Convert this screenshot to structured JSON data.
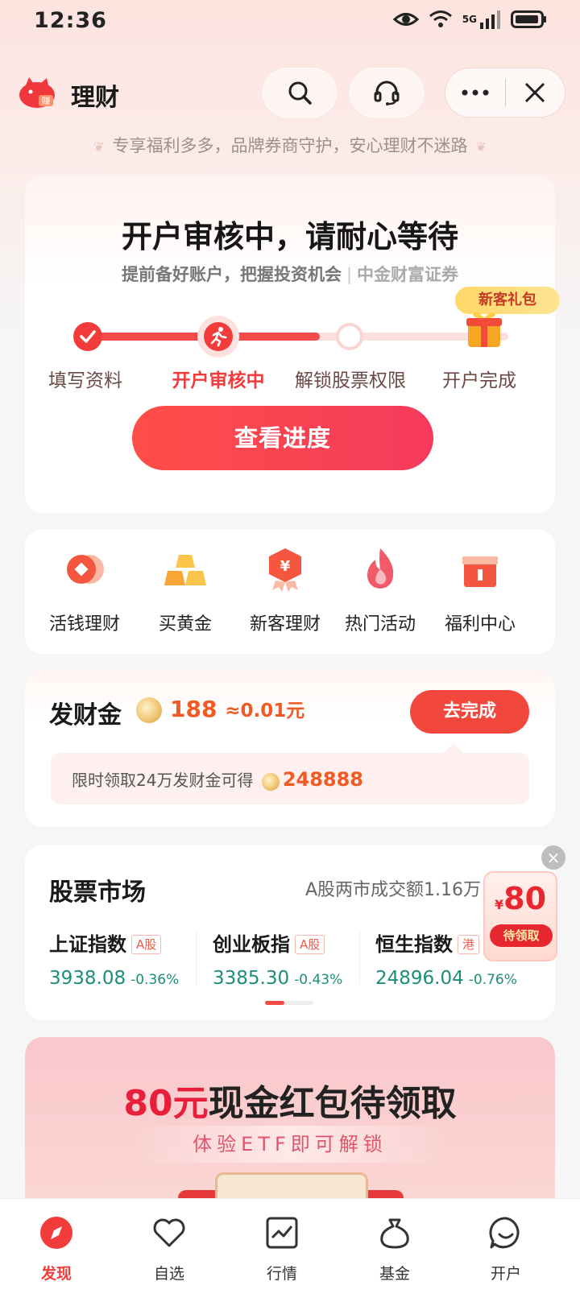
{
  "status_bar": {
    "time": "12:36",
    "network": "5G"
  },
  "header": {
    "title": "理财",
    "slogan": "专享福利多多，品牌券商守护，安心理财不迷路"
  },
  "account_card": {
    "headline": "开户审核中，请耐心等待",
    "subtitle": "提前备好账户，把握投资机会",
    "broker": "中金财富证券",
    "gift_badge": "新客礼包",
    "steps": [
      {
        "label": "填写资料",
        "state": "done"
      },
      {
        "label": "开户审核中",
        "state": "active"
      },
      {
        "label": "解锁股票权限",
        "state": "pending"
      },
      {
        "label": "开户完成",
        "state": "pending"
      }
    ],
    "progress_fraction": 0.55,
    "button_label": "查看进度"
  },
  "quick_entries": [
    {
      "label": "活钱理财",
      "icon": "coin-stack-icon"
    },
    {
      "label": "买黄金",
      "icon": "gold-bars-icon"
    },
    {
      "label": "新客理财",
      "icon": "yuan-badge-icon"
    },
    {
      "label": "热门活动",
      "icon": "flame-icon"
    },
    {
      "label": "福利中心",
      "icon": "gift-box-icon"
    }
  ],
  "bonus": {
    "title": "发财金",
    "amount": "188",
    "approx": "≈0.01元",
    "button_label": "去完成",
    "hint": "限时领取24万发财金可得",
    "hint_amount": "248888"
  },
  "market": {
    "title": "股票市场",
    "turnover": "A股两市成交额1.16万",
    "indices": [
      {
        "name": "上证指数",
        "tag": "A股",
        "value": "3938.08",
        "change": "-0.36%"
      },
      {
        "name": "创业板指",
        "tag": "A股",
        "value": "3385.30",
        "change": "-0.43%"
      },
      {
        "name": "恒生指数",
        "tag": "港",
        "value": "24896.04",
        "change": "-0.76%"
      }
    ]
  },
  "floating_redpacket": {
    "currency": "¥",
    "amount": "80",
    "claim_label": "待领取"
  },
  "banner": {
    "highlight": "80元",
    "headline_rest": "现金红包待领取",
    "strip": "体验ETF即可解锁"
  },
  "tabbar": [
    {
      "label": "发现",
      "icon": "compass-icon",
      "active": true
    },
    {
      "label": "自选",
      "icon": "heart-icon",
      "active": false
    },
    {
      "label": "行情",
      "icon": "chart-icon",
      "active": false
    },
    {
      "label": "基金",
      "icon": "money-bag-icon",
      "active": false
    },
    {
      "label": "开户",
      "icon": "smile-chat-icon",
      "active": false
    }
  ],
  "colors": {
    "accent": "#f23c3c",
    "gold": "#f05a25",
    "market_down": "#1d8e78"
  }
}
